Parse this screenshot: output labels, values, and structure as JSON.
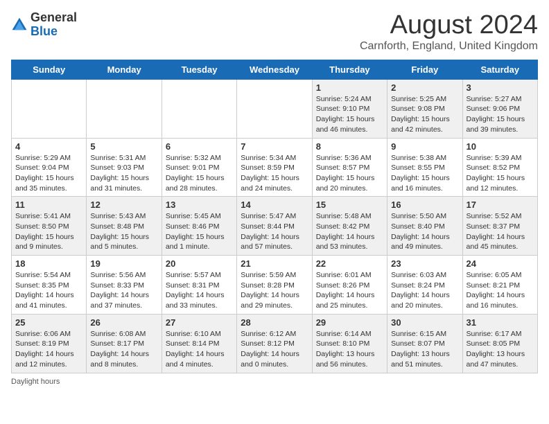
{
  "header": {
    "logo_general": "General",
    "logo_blue": "Blue",
    "title": "August 2024",
    "subtitle": "Carnforth, England, United Kingdom"
  },
  "days_of_week": [
    "Sunday",
    "Monday",
    "Tuesday",
    "Wednesday",
    "Thursday",
    "Friday",
    "Saturday"
  ],
  "weeks": [
    [
      {
        "day": "",
        "sunrise": "",
        "sunset": "",
        "daylight": ""
      },
      {
        "day": "",
        "sunrise": "",
        "sunset": "",
        "daylight": ""
      },
      {
        "day": "",
        "sunrise": "",
        "sunset": "",
        "daylight": ""
      },
      {
        "day": "",
        "sunrise": "",
        "sunset": "",
        "daylight": ""
      },
      {
        "day": "1",
        "sunrise": "5:24 AM",
        "sunset": "9:10 PM",
        "daylight": "15 hours and 46 minutes."
      },
      {
        "day": "2",
        "sunrise": "5:25 AM",
        "sunset": "9:08 PM",
        "daylight": "15 hours and 42 minutes."
      },
      {
        "day": "3",
        "sunrise": "5:27 AM",
        "sunset": "9:06 PM",
        "daylight": "15 hours and 39 minutes."
      }
    ],
    [
      {
        "day": "4",
        "sunrise": "5:29 AM",
        "sunset": "9:04 PM",
        "daylight": "15 hours and 35 minutes."
      },
      {
        "day": "5",
        "sunrise": "5:31 AM",
        "sunset": "9:03 PM",
        "daylight": "15 hours and 31 minutes."
      },
      {
        "day": "6",
        "sunrise": "5:32 AM",
        "sunset": "9:01 PM",
        "daylight": "15 hours and 28 minutes."
      },
      {
        "day": "7",
        "sunrise": "5:34 AM",
        "sunset": "8:59 PM",
        "daylight": "15 hours and 24 minutes."
      },
      {
        "day": "8",
        "sunrise": "5:36 AM",
        "sunset": "8:57 PM",
        "daylight": "15 hours and 20 minutes."
      },
      {
        "day": "9",
        "sunrise": "5:38 AM",
        "sunset": "8:55 PM",
        "daylight": "15 hours and 16 minutes."
      },
      {
        "day": "10",
        "sunrise": "5:39 AM",
        "sunset": "8:52 PM",
        "daylight": "15 hours and 12 minutes."
      }
    ],
    [
      {
        "day": "11",
        "sunrise": "5:41 AM",
        "sunset": "8:50 PM",
        "daylight": "15 hours and 9 minutes."
      },
      {
        "day": "12",
        "sunrise": "5:43 AM",
        "sunset": "8:48 PM",
        "daylight": "15 hours and 5 minutes."
      },
      {
        "day": "13",
        "sunrise": "5:45 AM",
        "sunset": "8:46 PM",
        "daylight": "15 hours and 1 minute."
      },
      {
        "day": "14",
        "sunrise": "5:47 AM",
        "sunset": "8:44 PM",
        "daylight": "14 hours and 57 minutes."
      },
      {
        "day": "15",
        "sunrise": "5:48 AM",
        "sunset": "8:42 PM",
        "daylight": "14 hours and 53 minutes."
      },
      {
        "day": "16",
        "sunrise": "5:50 AM",
        "sunset": "8:40 PM",
        "daylight": "14 hours and 49 minutes."
      },
      {
        "day": "17",
        "sunrise": "5:52 AM",
        "sunset": "8:37 PM",
        "daylight": "14 hours and 45 minutes."
      }
    ],
    [
      {
        "day": "18",
        "sunrise": "5:54 AM",
        "sunset": "8:35 PM",
        "daylight": "14 hours and 41 minutes."
      },
      {
        "day": "19",
        "sunrise": "5:56 AM",
        "sunset": "8:33 PM",
        "daylight": "14 hours and 37 minutes."
      },
      {
        "day": "20",
        "sunrise": "5:57 AM",
        "sunset": "8:31 PM",
        "daylight": "14 hours and 33 minutes."
      },
      {
        "day": "21",
        "sunrise": "5:59 AM",
        "sunset": "8:28 PM",
        "daylight": "14 hours and 29 minutes."
      },
      {
        "day": "22",
        "sunrise": "6:01 AM",
        "sunset": "8:26 PM",
        "daylight": "14 hours and 25 minutes."
      },
      {
        "day": "23",
        "sunrise": "6:03 AM",
        "sunset": "8:24 PM",
        "daylight": "14 hours and 20 minutes."
      },
      {
        "day": "24",
        "sunrise": "6:05 AM",
        "sunset": "8:21 PM",
        "daylight": "14 hours and 16 minutes."
      }
    ],
    [
      {
        "day": "25",
        "sunrise": "6:06 AM",
        "sunset": "8:19 PM",
        "daylight": "14 hours and 12 minutes."
      },
      {
        "day": "26",
        "sunrise": "6:08 AM",
        "sunset": "8:17 PM",
        "daylight": "14 hours and 8 minutes."
      },
      {
        "day": "27",
        "sunrise": "6:10 AM",
        "sunset": "8:14 PM",
        "daylight": "14 hours and 4 minutes."
      },
      {
        "day": "28",
        "sunrise": "6:12 AM",
        "sunset": "8:12 PM",
        "daylight": "14 hours and 0 minutes."
      },
      {
        "day": "29",
        "sunrise": "6:14 AM",
        "sunset": "8:10 PM",
        "daylight": "13 hours and 56 minutes."
      },
      {
        "day": "30",
        "sunrise": "6:15 AM",
        "sunset": "8:07 PM",
        "daylight": "13 hours and 51 minutes."
      },
      {
        "day": "31",
        "sunrise": "6:17 AM",
        "sunset": "8:05 PM",
        "daylight": "13 hours and 47 minutes."
      }
    ]
  ],
  "footer": {
    "daylight_label": "Daylight hours"
  }
}
